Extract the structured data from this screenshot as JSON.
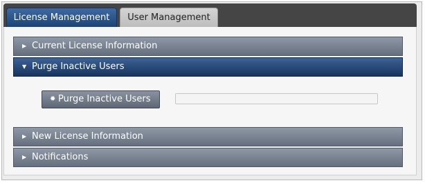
{
  "tabs": [
    {
      "label": "License Management",
      "active": true
    },
    {
      "label": "User Management",
      "active": false
    }
  ],
  "sections": [
    {
      "label": "Current License Information",
      "expanded": false,
      "arrow": "▶"
    },
    {
      "label": "Purge Inactive Users",
      "expanded": true,
      "arrow": "▼"
    },
    {
      "label": "New License Information",
      "expanded": false,
      "arrow": "▶"
    },
    {
      "label": "Notifications",
      "expanded": false,
      "arrow": "▶"
    }
  ],
  "purge": {
    "button_label": "Purge Inactive Users",
    "button_icon": "gear-icon",
    "progress": 0
  },
  "colors": {
    "active_accent": "#1c4376",
    "header_gray": "#656f7d"
  }
}
